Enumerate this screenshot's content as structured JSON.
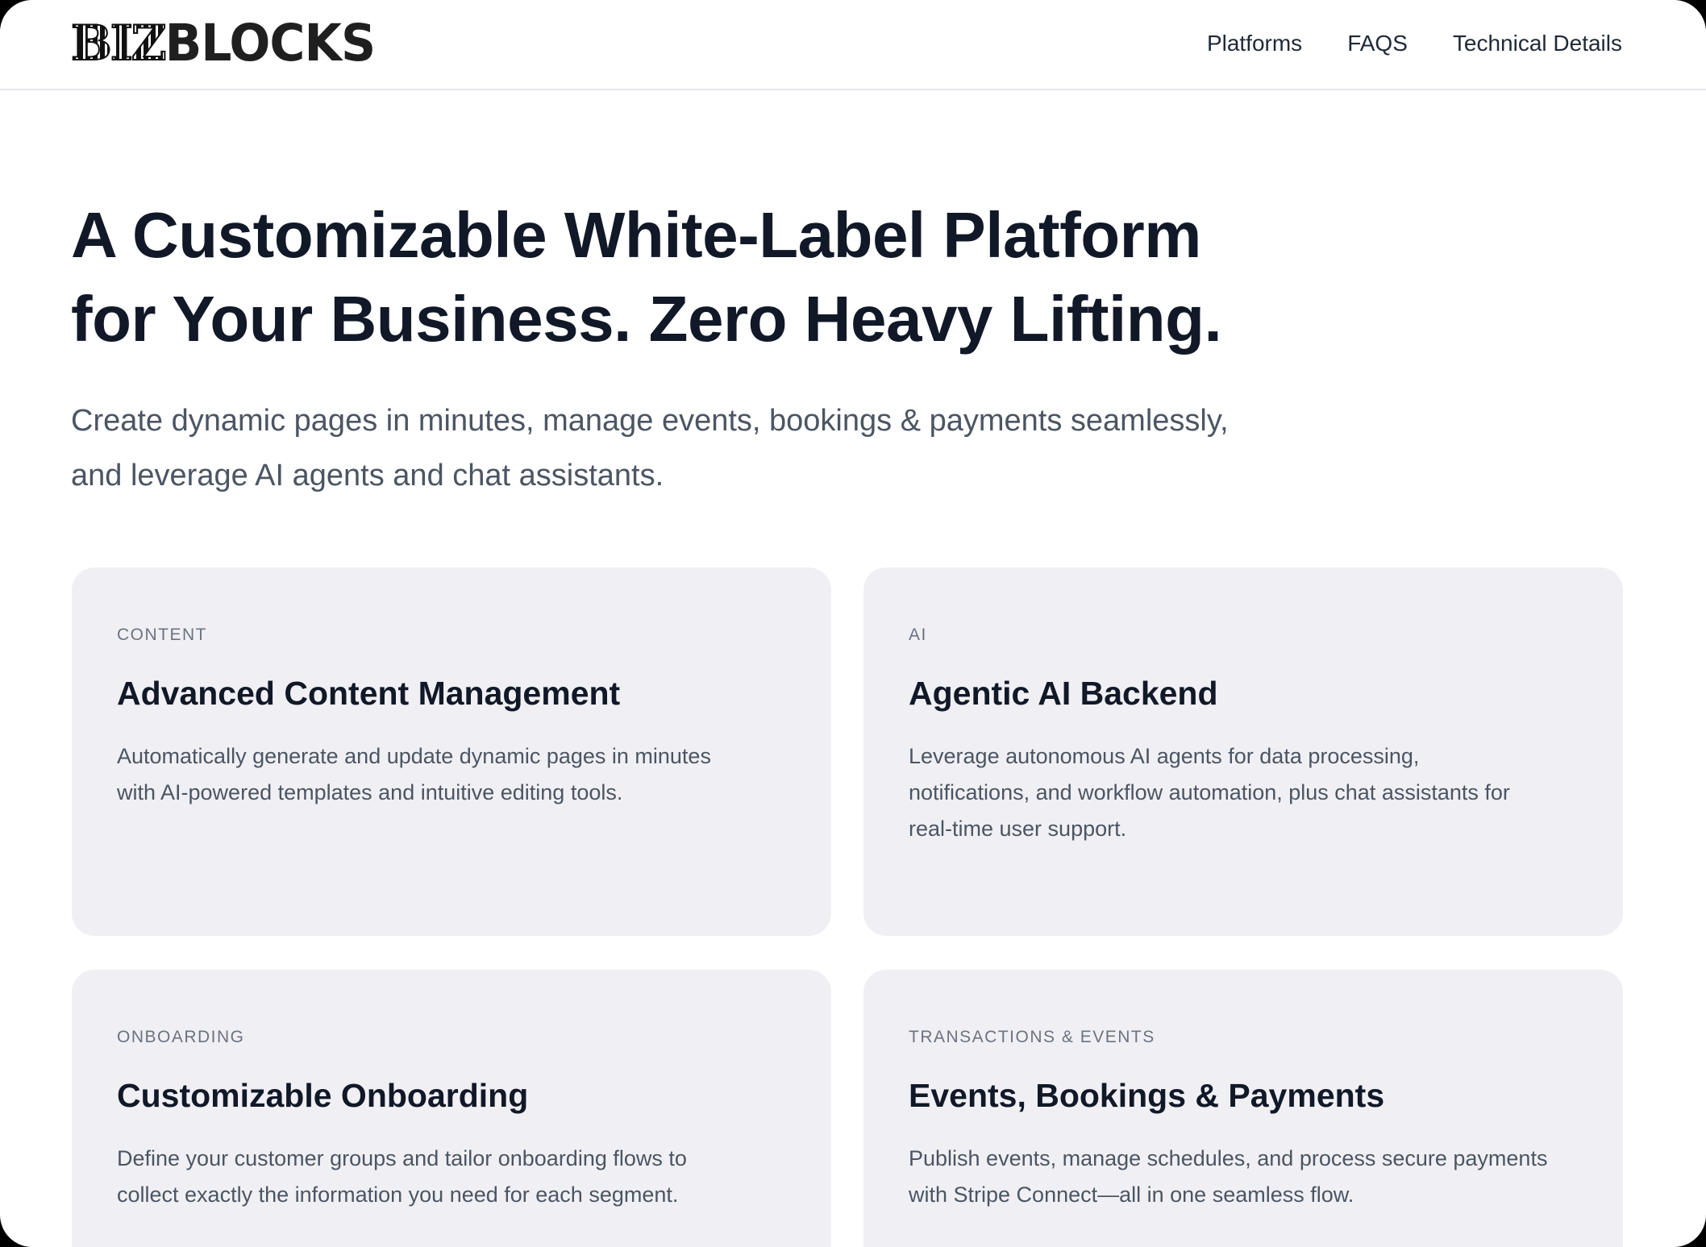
{
  "header": {
    "logo_part1": "BIZ",
    "logo_part2": "BLOCKS",
    "nav": {
      "platforms": "Platforms",
      "faqs": "FAQS",
      "technical_details": "Technical Details"
    }
  },
  "hero": {
    "title_line1": "A Customizable White-Label Platform",
    "title_line2": "for Your Business. Zero Heavy Lifting.",
    "subtitle_line1": "Create dynamic pages in minutes, manage events, bookings & payments seamlessly,",
    "subtitle_line2": "and leverage AI agents and chat assistants."
  },
  "features": [
    {
      "tag": "CONTENT",
      "title": "Advanced Content Management",
      "desc_line1": "Automatically generate and update dynamic pages in minutes",
      "desc_line2": "with AI-powered templates and intuitive editing tools.",
      "desc_line3": ""
    },
    {
      "tag": "AI",
      "title": "Agentic AI Backend",
      "desc_line1": "Leverage autonomous AI agents for data processing,",
      "desc_line2": "notifications, and workflow automation, plus chat assistants for",
      "desc_line3": "real-time user support."
    },
    {
      "tag": "ONBOARDING",
      "title": "Customizable Onboarding",
      "desc_line1": "Define your customer groups and tailor onboarding flows to",
      "desc_line2": "collect exactly the information you need for each segment.",
      "desc_line3": ""
    },
    {
      "tag": "TRANSACTIONS & EVENTS",
      "title": "Events, Bookings & Payments",
      "desc_line1": "Publish events, manage schedules, and process secure payments",
      "desc_line2": "with Stripe Connect—all in one seamless flow.",
      "desc_line3": ""
    }
  ],
  "colors": {
    "card_bg": "#f0f0f4",
    "title_text": "#111827",
    "body_text": "#4b5563"
  }
}
